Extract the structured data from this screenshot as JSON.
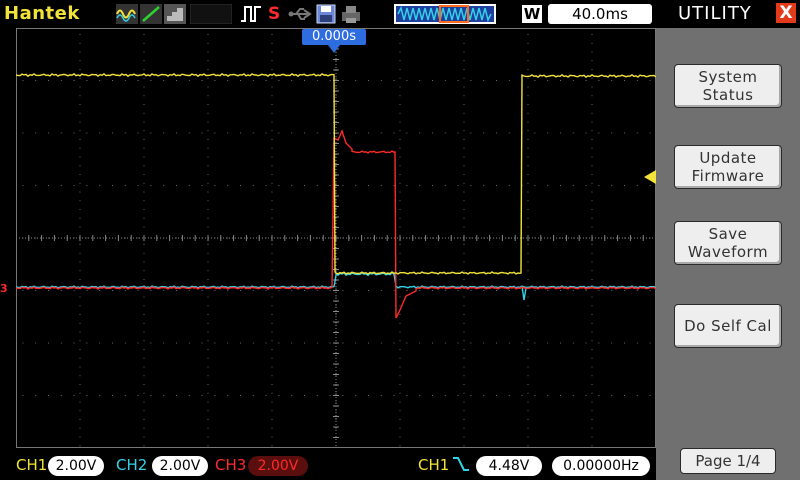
{
  "brand": {
    "logo_text": "Hantek"
  },
  "toolbar": {
    "timebase": "40.0ms",
    "window_mode": "W",
    "trigger_edge_letter": "S"
  },
  "display": {
    "trigger_time": "0.000s",
    "ch3_marker": "3"
  },
  "channels": [
    {
      "label": "CH1",
      "scale": "2.00V",
      "color": "#f2e33a"
    },
    {
      "label": "CH2",
      "scale": "2.00V",
      "color": "#35d2e6"
    },
    {
      "label": "CH3",
      "scale": "2.00V",
      "color": "#ff2a2a"
    }
  ],
  "trigger": {
    "source": "CH1",
    "level": "4.48V",
    "frequency": "0.00000Hz"
  },
  "side_menu": {
    "title": "UTILITY",
    "close": "X",
    "buttons": [
      {
        "line1": "System",
        "line2": "Status"
      },
      {
        "line1": "Update",
        "line2": "Firmware"
      },
      {
        "line1": "Save",
        "line2": "Waveform"
      },
      {
        "line1": "Do Self Cal",
        "line2": ""
      }
    ],
    "page": "Page 1/4"
  },
  "icons": {
    "waveform": "wave-icon",
    "ramp": "ramp-icon",
    "menu": "stair-icon",
    "trigger_pulse": "pulse-icon",
    "usb": "usb-icon",
    "save": "save-disk-icon",
    "print": "printer-icon",
    "timebase_bar": "timebase-wave-icon",
    "close": "close-icon",
    "selection": "selection-arrow-icon"
  },
  "colors": {
    "ch1": "#f2e33a",
    "ch2": "#35d2e6",
    "ch3": "#ff2a2a",
    "trigger_marker": "#2d6de0",
    "panel": "#707070"
  }
}
